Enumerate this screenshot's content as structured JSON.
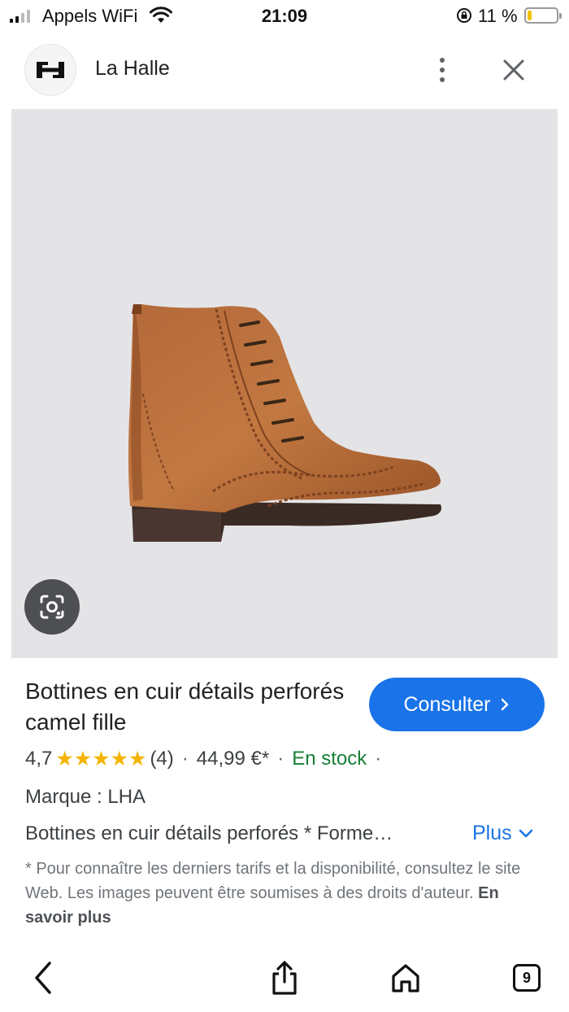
{
  "status_bar": {
    "carrier": "Appels WiFi",
    "time": "21:09",
    "battery_percent": "11 %"
  },
  "header": {
    "site_name": "La Halle",
    "logo_icon": "la-halle-logo",
    "menu_icon": "more-vert-icon",
    "close_icon": "close-icon"
  },
  "product": {
    "title": "Bottines en cuir détails perforés camel fille",
    "visit_label": "Consulter",
    "rating": "4,7",
    "stars": "★★★★★",
    "review_count": "(4)",
    "price": "44,99 €*",
    "stock": "En stock",
    "brand": "Marque : LHA",
    "description": "Bottines en cuir détails perforés * Forme…",
    "more_label": "Plus",
    "disclaimer": "* Pour connaître les derniers tarifs et la disponibilité, consultez le site Web. Les images peuvent être soumises à des droits d'auteur.",
    "learn_more": "En savoir plus"
  },
  "toolbar": {
    "tabs_count": "9"
  },
  "colors": {
    "accent": "#1a73e8",
    "stock_green": "#188038",
    "star_yellow": "#f4b400",
    "image_bg": "#e4e4e6"
  }
}
